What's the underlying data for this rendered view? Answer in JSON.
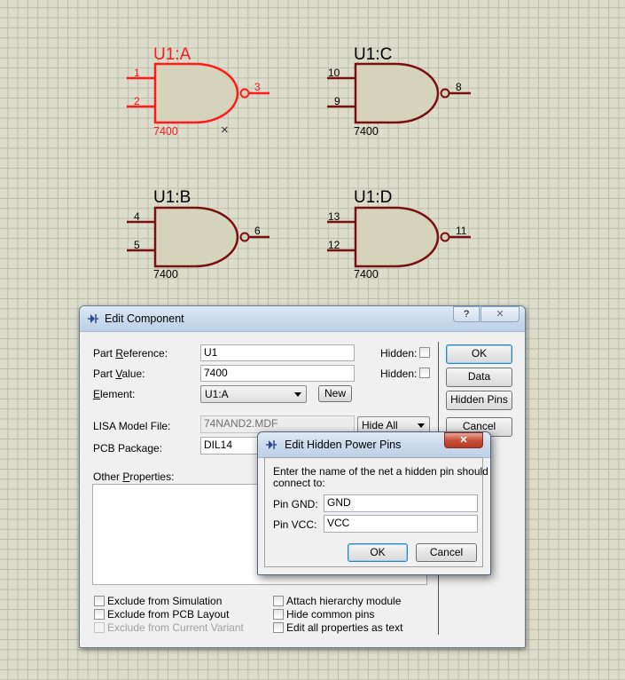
{
  "gates": [
    {
      "title": "U1:A",
      "value": "7400",
      "pins": [
        "1",
        "2",
        "3"
      ],
      "selected": true,
      "cursor_mark": "×"
    },
    {
      "title": "U1:C",
      "value": "7400",
      "pins": [
        "10",
        "9",
        "8"
      ],
      "selected": false
    },
    {
      "title": "U1:B",
      "value": "7400",
      "pins": [
        "4",
        "5",
        "6"
      ],
      "selected": false
    },
    {
      "title": "U1:D",
      "value": "7400",
      "pins": [
        "13",
        "12",
        "11"
      ],
      "selected": false
    }
  ],
  "colors": {
    "gate_fill": "#d6d3bb",
    "gate_stroke": "#7a0f0f",
    "selected_stroke": "#ff1a1a",
    "grid_bg": "#dcdccc"
  },
  "edit_component": {
    "title": "Edit Component",
    "help_button": "?",
    "close_button": "✕",
    "part_reference_label": "Part Reference:",
    "part_reference_value": "U1",
    "part_value_label": "Part Value:",
    "part_value_value": "7400",
    "element_label": "Element:",
    "element_value": "U1:A",
    "new_button": "New",
    "hidden_label_1": "Hidden:",
    "hidden_label_2": "Hidden:",
    "lisa_label": "LISA Model File:",
    "lisa_value": "74NAND2.MDF",
    "hide_all_value": "Hide All",
    "pcb_package_label": "PCB Package:",
    "pcb_package_value": "DIL14",
    "other_properties_label": "Other Properties:",
    "ok_button": "OK",
    "data_button": "Data",
    "hidden_pins_button": "Hidden Pins",
    "cancel_button": "Cancel",
    "checkboxes_left": [
      {
        "label": "Exclude from Simulation",
        "checked": false,
        "disabled": false
      },
      {
        "label": "Exclude from PCB Layout",
        "checked": false,
        "disabled": false
      },
      {
        "label": "Exclude from Current Variant",
        "checked": false,
        "disabled": true
      }
    ],
    "checkboxes_right": [
      {
        "label": "Attach hierarchy module",
        "checked": false
      },
      {
        "label": "Hide common pins",
        "checked": false
      },
      {
        "label": "Edit all properties as text",
        "checked": false
      }
    ]
  },
  "edit_hidden_pins": {
    "title": "Edit Hidden Power Pins",
    "close_button": "✕",
    "instruction_line1": "Enter the name of the net a hidden pin should",
    "instruction_line2": "connect to:",
    "pin_gnd_label": "Pin GND:",
    "pin_gnd_value": "GND",
    "pin_vcc_label": "Pin VCC:",
    "pin_vcc_value": "VCC",
    "ok_button": "OK",
    "cancel_button": "Cancel"
  }
}
